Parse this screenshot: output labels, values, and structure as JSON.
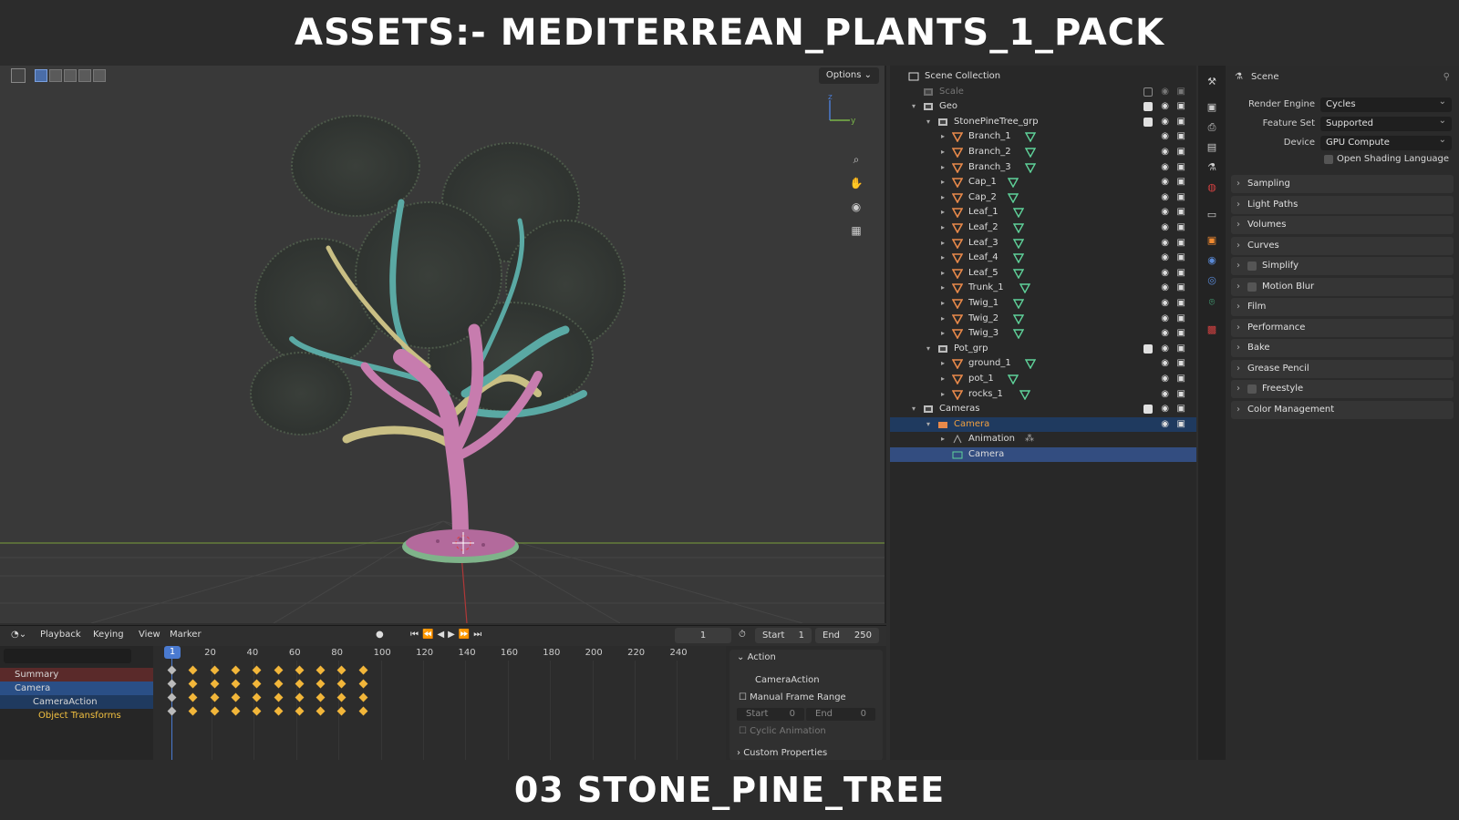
{
  "banner": {
    "top": "ASSETS:- MEDITERREAN_PLANTS_1_PACK",
    "bottom": "03 STONE_PINE_TREE"
  },
  "viewport": {
    "options_label": "Options",
    "gizmo_z": "z",
    "gizmo_y": "y"
  },
  "timeline": {
    "menus": [
      "Playback",
      "Keying",
      "View",
      "Marker"
    ],
    "current_frame": "1",
    "start_label": "Start",
    "start_value": "1",
    "end_label": "End",
    "end_value": "250",
    "ticks": [
      "20",
      "40",
      "60",
      "80",
      "100",
      "120",
      "140",
      "160",
      "180",
      "200",
      "220",
      "240"
    ],
    "channels": [
      {
        "label": "Summary"
      },
      {
        "label": "Camera"
      },
      {
        "label": "CameraAction"
      },
      {
        "label": "Object Transforms"
      }
    ],
    "action_panel": {
      "header": "Action",
      "action_name": "CameraAction",
      "manual_range": "Manual Frame Range",
      "start_label": "Start",
      "start_value": "0",
      "end_label": "End",
      "end_value": "0",
      "cyclic": "Cyclic Animation",
      "custom_props": "Custom Properties"
    }
  },
  "outliner": {
    "rows": [
      {
        "label": "Scene Collection",
        "indent": 0,
        "type": "scene"
      },
      {
        "label": "Scale",
        "indent": 1,
        "type": "coll-dim"
      },
      {
        "label": "Geo",
        "indent": 1,
        "type": "coll"
      },
      {
        "label": "StonePineTree_grp",
        "indent": 2,
        "type": "coll"
      },
      {
        "label": "Branch_1",
        "indent": 3,
        "type": "mesh"
      },
      {
        "label": "Branch_2",
        "indent": 3,
        "type": "mesh"
      },
      {
        "label": "Branch_3",
        "indent": 3,
        "type": "mesh"
      },
      {
        "label": "Cap_1",
        "indent": 3,
        "type": "mesh"
      },
      {
        "label": "Cap_2",
        "indent": 3,
        "type": "mesh"
      },
      {
        "label": "Leaf_1",
        "indent": 3,
        "type": "mesh"
      },
      {
        "label": "Leaf_2",
        "indent": 3,
        "type": "mesh"
      },
      {
        "label": "Leaf_3",
        "indent": 3,
        "type": "mesh"
      },
      {
        "label": "Leaf_4",
        "indent": 3,
        "type": "mesh"
      },
      {
        "label": "Leaf_5",
        "indent": 3,
        "type": "mesh"
      },
      {
        "label": "Trunk_1",
        "indent": 3,
        "type": "mesh"
      },
      {
        "label": "Twig_1",
        "indent": 3,
        "type": "mesh"
      },
      {
        "label": "Twig_2",
        "indent": 3,
        "type": "mesh"
      },
      {
        "label": "Twig_3",
        "indent": 3,
        "type": "mesh"
      },
      {
        "label": "Pot_grp",
        "indent": 2,
        "type": "coll"
      },
      {
        "label": "ground_1",
        "indent": 3,
        "type": "mesh"
      },
      {
        "label": "pot_1",
        "indent": 3,
        "type": "mesh"
      },
      {
        "label": "rocks_1",
        "indent": 3,
        "type": "mesh"
      },
      {
        "label": "Cameras",
        "indent": 1,
        "type": "coll"
      },
      {
        "label": "Camera",
        "indent": 2,
        "type": "camera"
      },
      {
        "label": "Animation",
        "indent": 3,
        "type": "anim"
      },
      {
        "label": "Camera",
        "indent": 3,
        "type": "camdata"
      }
    ]
  },
  "properties": {
    "header": "Scene",
    "render_engine_label": "Render Engine",
    "render_engine_value": "Cycles",
    "feature_set_label": "Feature Set",
    "feature_set_value": "Supported",
    "device_label": "Device",
    "device_value": "GPU Compute",
    "osl_label": "Open Shading Language",
    "panels": [
      {
        "label": "Sampling",
        "checkbox": false
      },
      {
        "label": "Light Paths",
        "checkbox": false
      },
      {
        "label": "Volumes",
        "checkbox": false
      },
      {
        "label": "Curves",
        "checkbox": false
      },
      {
        "label": "Simplify",
        "checkbox": true
      },
      {
        "label": "Motion Blur",
        "checkbox": true
      },
      {
        "label": "Film",
        "checkbox": false
      },
      {
        "label": "Performance",
        "checkbox": false
      },
      {
        "label": "Bake",
        "checkbox": false
      },
      {
        "label": "Grease Pencil",
        "checkbox": false
      },
      {
        "label": "Freestyle",
        "checkbox": true
      },
      {
        "label": "Color Management",
        "checkbox": false
      }
    ]
  },
  "colors": {
    "accent": "#4a7ad0",
    "selection": "#334d80",
    "keyframe": "#f2b63a",
    "mesh_icon": "#e8894a",
    "modifier_icon": "#5fd39a"
  }
}
